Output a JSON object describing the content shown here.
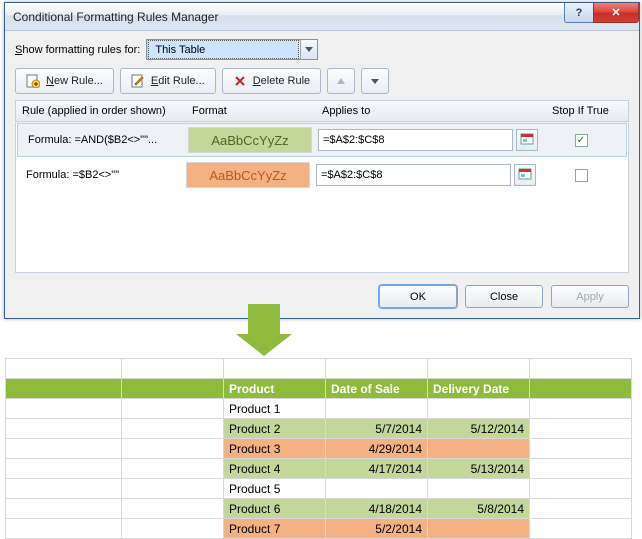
{
  "dialog": {
    "title": "Conditional Formatting Rules Manager",
    "show_label_pre": "S",
    "show_label_post": "how formatting rules for:",
    "scope_value": "This Table",
    "toolbar": {
      "new_u": "N",
      "new_rest": "ew Rule...",
      "edit_u": "E",
      "edit_rest": "dit Rule...",
      "del_u": "D",
      "del_rest": "elete Rule"
    },
    "headers": {
      "rule": "Rule (applied in order shown)",
      "format": "Format",
      "applies": "Applies to",
      "stop": "Stop If True"
    },
    "rules": [
      {
        "formula": "Formula: =AND($B2<>\"\"...",
        "preview": "AaBbCcYyZz",
        "previewClass": "fmt-green",
        "applies": "=$A$2:$C$8",
        "stop": true
      },
      {
        "formula": "Formula: =$B2<>\"\"",
        "preview": "AaBbCcYyZz",
        "previewClass": "fmt-orange",
        "applies": "=$A$2:$C$8",
        "stop": false
      }
    ],
    "buttons": {
      "ok": "OK",
      "close": "Close",
      "apply": "Apply"
    }
  },
  "sheet": {
    "headers": {
      "product": "Product",
      "sale": "Date of Sale",
      "delivery": "Delivery Date"
    },
    "rows": [
      {
        "p": "Product 1",
        "s": "",
        "d": "",
        "cls": ""
      },
      {
        "p": "Product 2",
        "s": "5/7/2014",
        "d": "5/12/2014",
        "cls": "g"
      },
      {
        "p": "Product 3",
        "s": "4/29/2014",
        "d": "",
        "cls": "o"
      },
      {
        "p": "Product 4",
        "s": "4/17/2014",
        "d": "5/13/2014",
        "cls": "g"
      },
      {
        "p": "Product 5",
        "s": "",
        "d": "",
        "cls": ""
      },
      {
        "p": "Product 6",
        "s": "4/18/2014",
        "d": "5/8/2014",
        "cls": "g"
      },
      {
        "p": "Product 7",
        "s": "5/2/2014",
        "d": "",
        "cls": "o"
      }
    ]
  }
}
